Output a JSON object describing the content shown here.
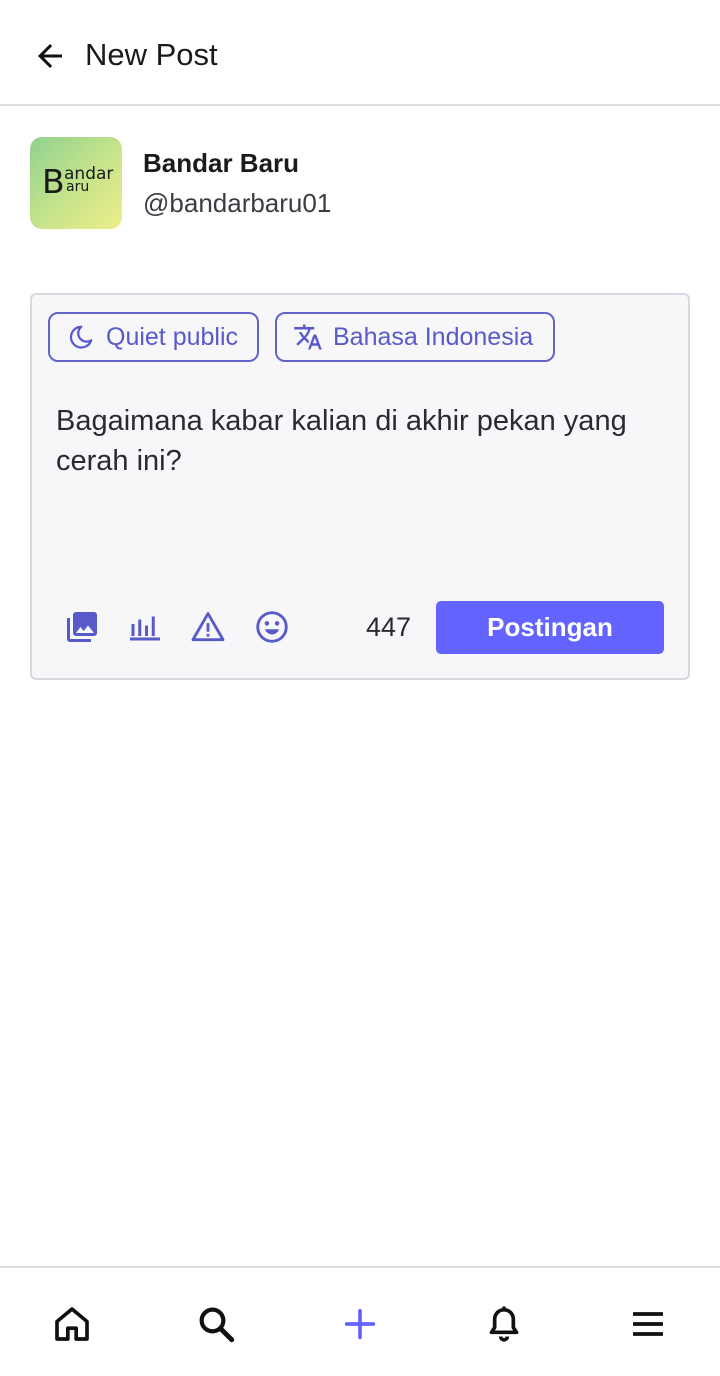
{
  "header": {
    "back_icon": "arrow-left-icon",
    "title": "New Post"
  },
  "profile": {
    "avatar_text_big": "B",
    "avatar_text_top": "andar",
    "avatar_text_bottom": "aru",
    "display_name": "Bandar Baru",
    "handle": "@bandarbaru01"
  },
  "composer": {
    "privacy_chip": {
      "label": "Quiet public",
      "icon": "moon-icon"
    },
    "language_chip": {
      "label": "Bahasa Indonesia",
      "icon": "translate-icon"
    },
    "text": "Bagaimana kabar kalian di akhir pekan yang cerah ini?",
    "tools": [
      "media-icon",
      "poll-icon",
      "warning-icon",
      "emoji-icon"
    ],
    "char_count": "447",
    "post_button": "Postingan"
  },
  "bottom_nav": {
    "items": [
      "home-icon",
      "search-icon",
      "plus-icon",
      "bell-icon",
      "menu-icon"
    ]
  },
  "colors": {
    "accent": "#6364ff",
    "chip": "#595aca",
    "composer_bg": "#f7f7fa"
  }
}
